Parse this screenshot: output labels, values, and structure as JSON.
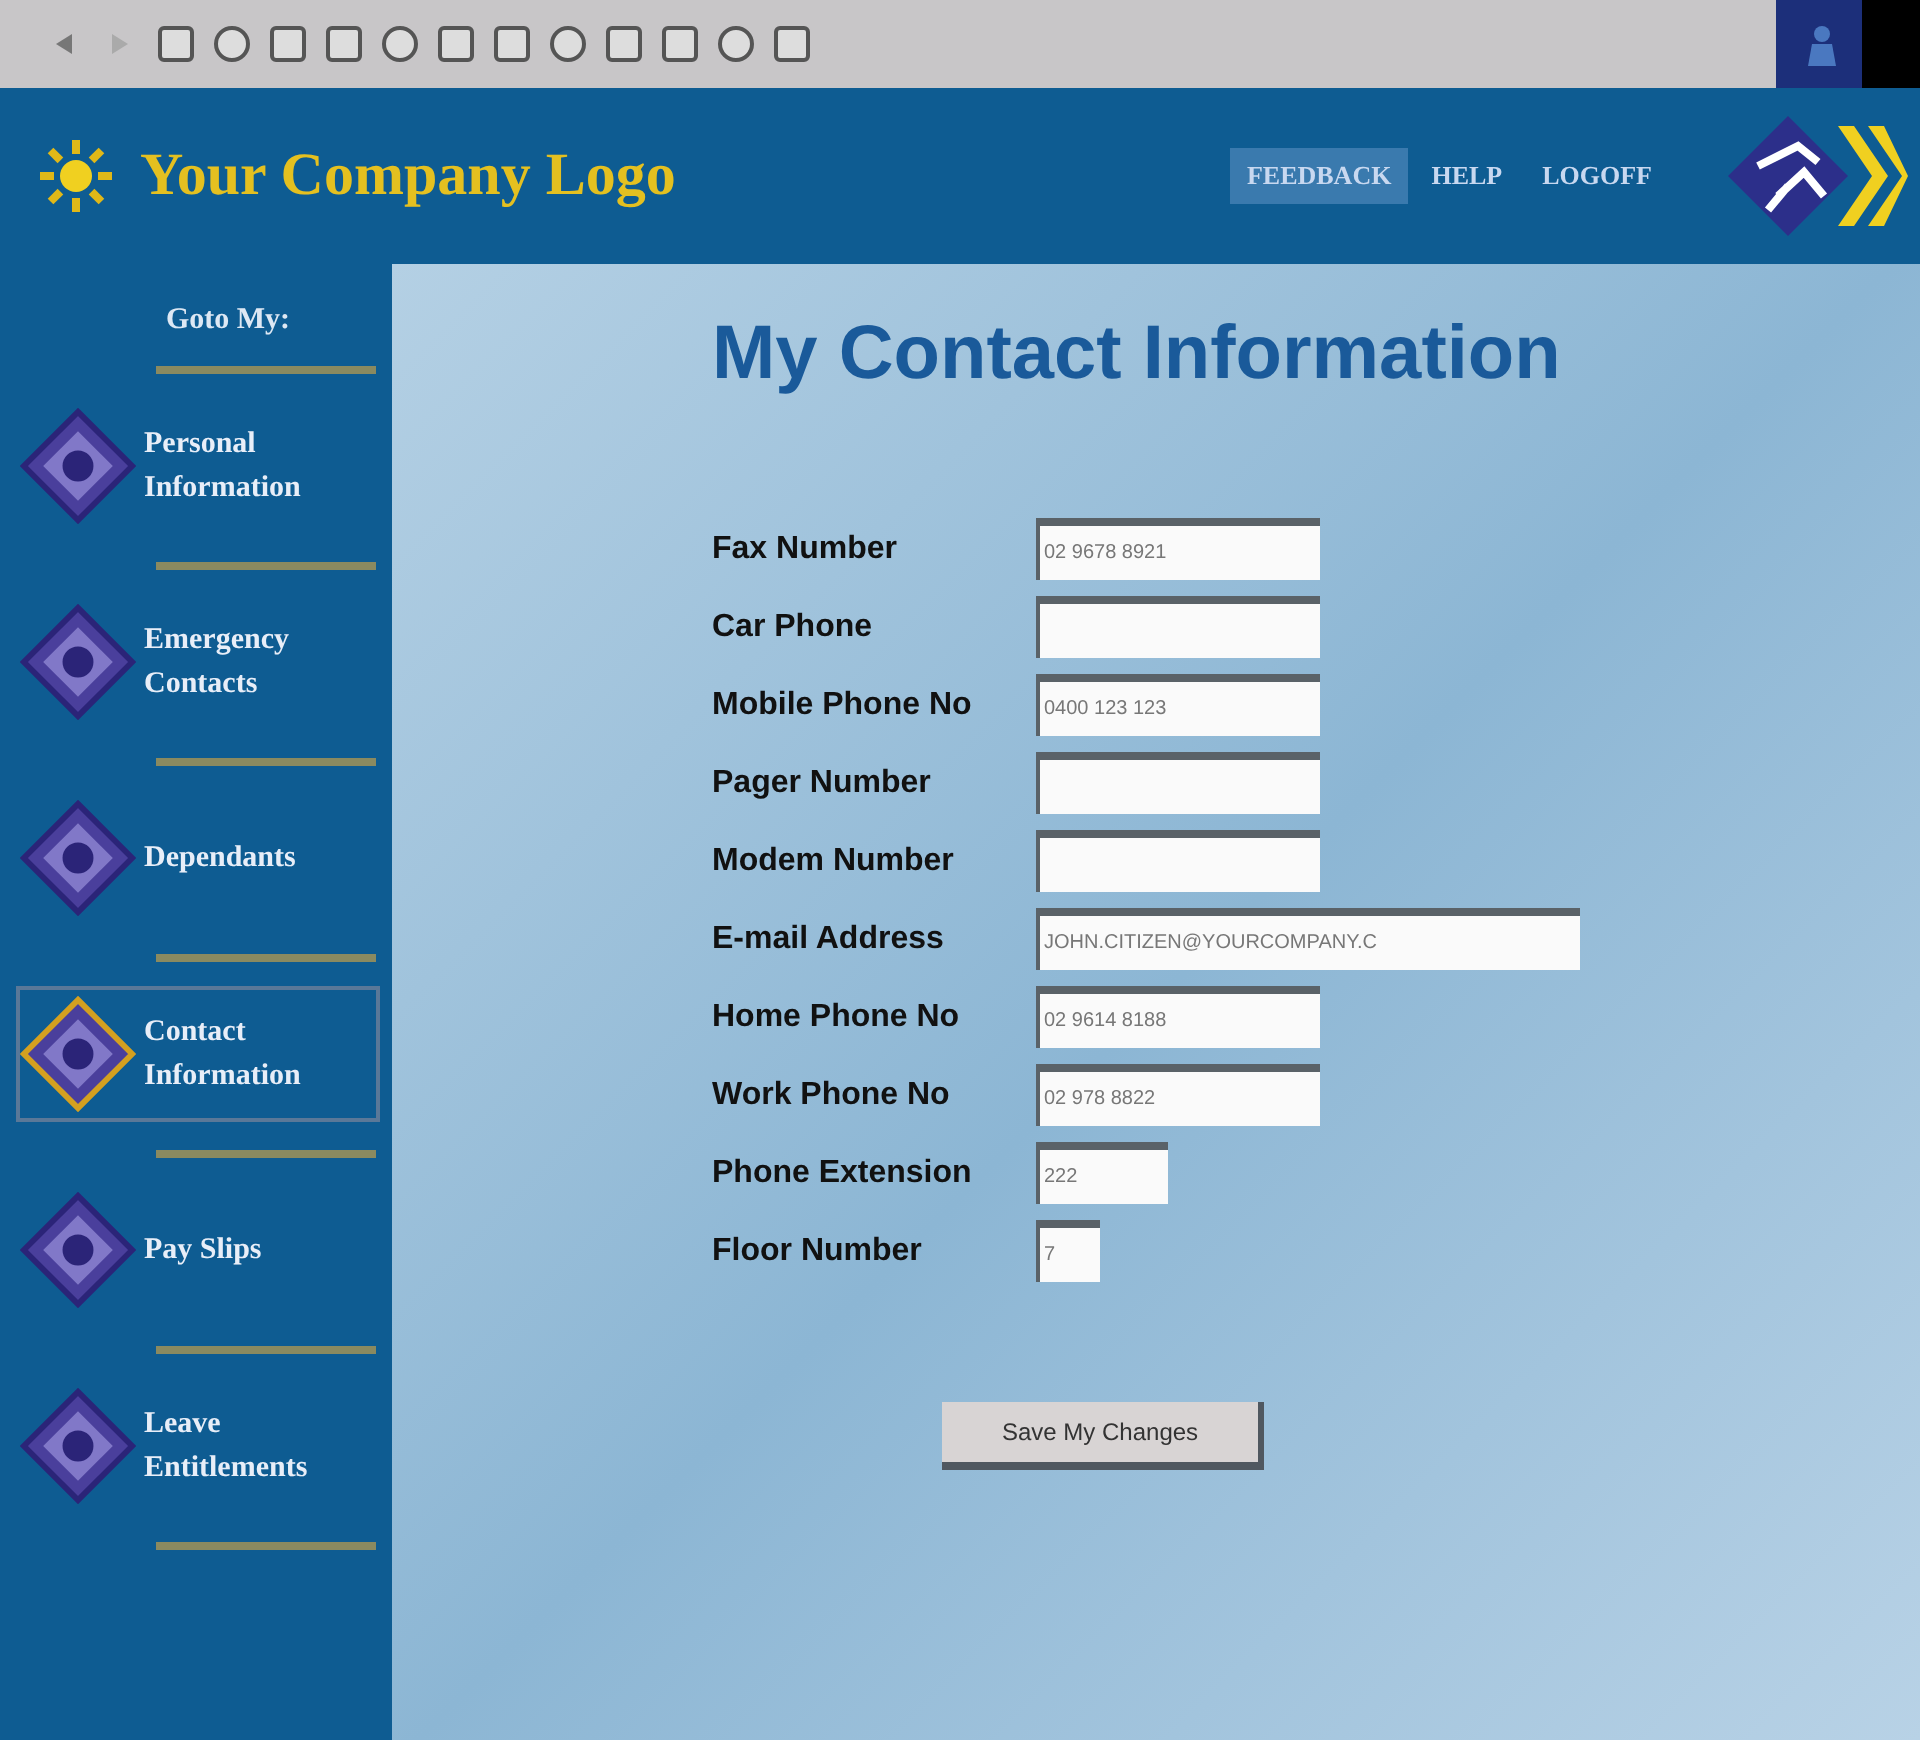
{
  "header": {
    "logo_text": "Your Company Logo",
    "nav": [
      {
        "label": "FEEDBACK",
        "selected": true
      },
      {
        "label": "HELP",
        "selected": false
      },
      {
        "label": "LOGOFF",
        "selected": false
      }
    ]
  },
  "sidebar": {
    "heading": "Goto My:",
    "items": [
      {
        "label": "Personal Information",
        "selected": false
      },
      {
        "label": "Emergency Contacts",
        "selected": false
      },
      {
        "label": "Dependants",
        "selected": false
      },
      {
        "label": "Contact Information",
        "selected": true
      },
      {
        "label": "Pay Slips",
        "selected": false
      },
      {
        "label": "Leave Entitlements",
        "selected": false
      }
    ]
  },
  "main": {
    "title": "My Contact Information",
    "fields": [
      {
        "label": "Fax Number",
        "value": "02 9678 8921",
        "kind": "text"
      },
      {
        "label": "Car Phone",
        "kind": "text"
      },
      {
        "label": "Mobile Phone No",
        "value": "0400 123 123",
        "kind": "text"
      },
      {
        "label": "Pager Number",
        "kind": "text"
      },
      {
        "label": "Modem Number",
        "kind": "text"
      },
      {
        "label": "E-mail Address",
        "value": "JOHN.CITIZEN@YOURCOMPANY.C",
        "kind": "email"
      },
      {
        "label": "Home Phone No",
        "value": "02 9614 8188",
        "kind": "text"
      },
      {
        "label": "Work Phone No",
        "value": "02 978 8822",
        "kind": "text"
      },
      {
        "label": "Phone Extension",
        "value": "222",
        "kind": "extension"
      },
      {
        "label": "Floor Number",
        "value": "7",
        "kind": "floor"
      }
    ],
    "save_button": "Save My Changes"
  }
}
